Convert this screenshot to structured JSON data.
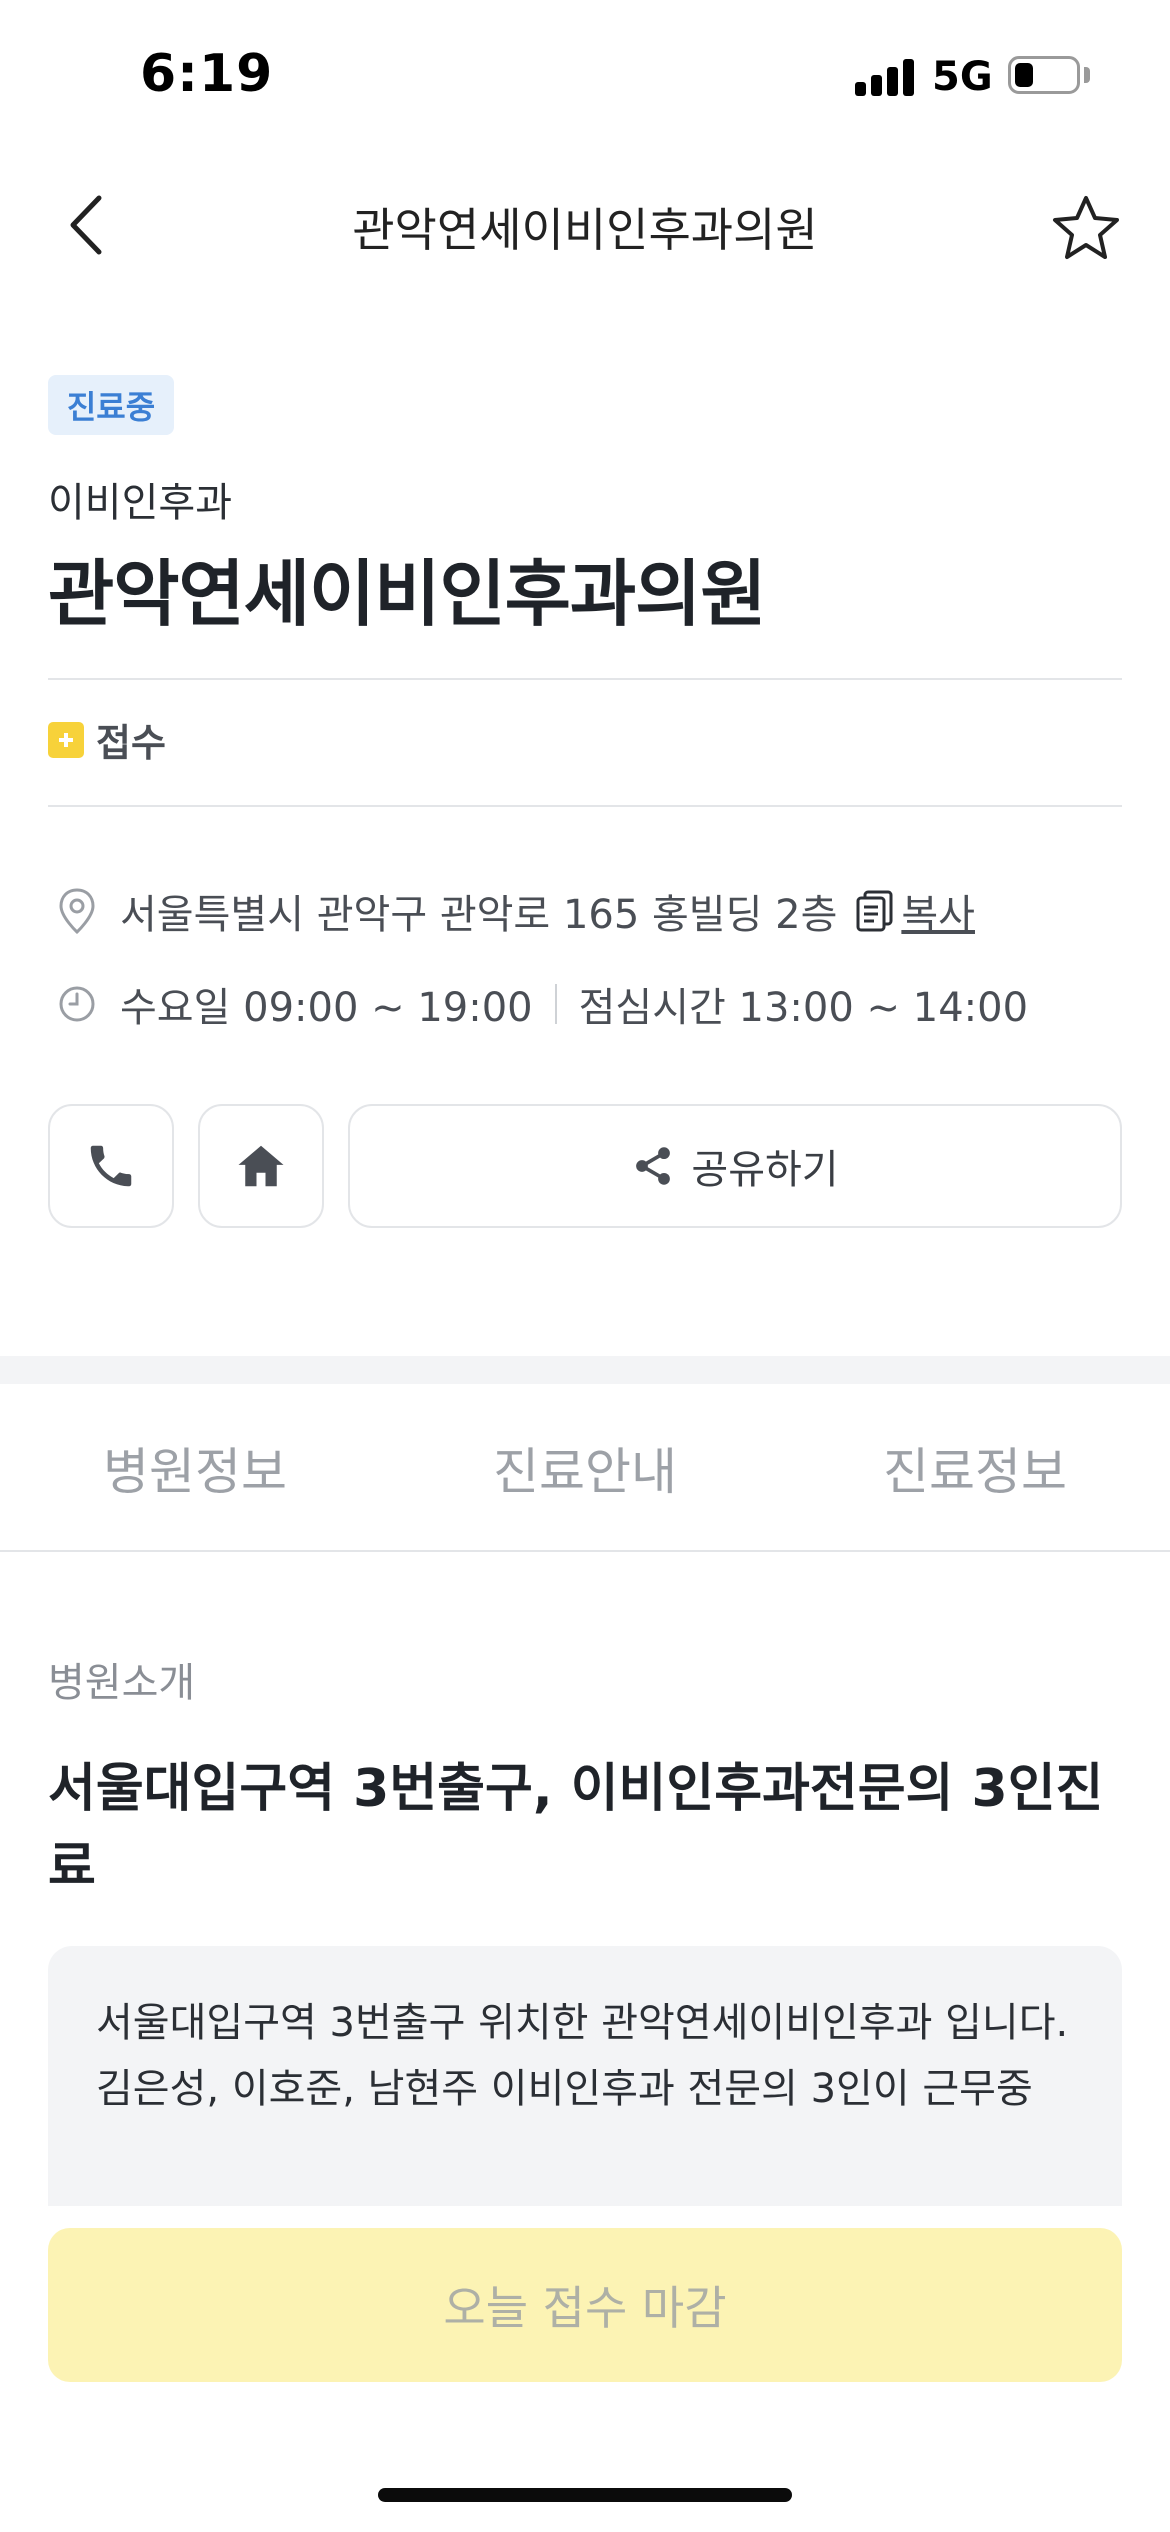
{
  "status_bar": {
    "time": "6:19",
    "network": "5G"
  },
  "nav": {
    "title": "관악연세이비인후과의원",
    "back_icon": "chevron-left-icon",
    "favorite_icon": "star-outline-icon"
  },
  "hospital": {
    "status_badge": "진료중",
    "department": "이비인후과",
    "name": "관악연세이비인후과의원",
    "reception_label": "접수"
  },
  "info": {
    "address": "서울특별시 관악구 관악로 165 홍빌딩 2층",
    "copy_label": "복사",
    "hours": "수요일 09:00 ~ 19:00",
    "lunch": "점심시간 13:00 ~ 14:00"
  },
  "actions": {
    "share_label": "공유하기"
  },
  "tabs": [
    {
      "label": "병원정보"
    },
    {
      "label": "진료안내"
    },
    {
      "label": "진료정보"
    }
  ],
  "intro": {
    "section_label": "병원소개",
    "title": "서울대입구역 3번출구, 이비인후과전문의 3인진료",
    "body": "서울대입구역 3번출구 위치한 관악연세이비인후과 입니다.\n김은성, 이호준, 남현주 이비인후과 전문의 3인이 근무중"
  },
  "bottom_button": {
    "label": "오늘 접수 마감"
  },
  "colors": {
    "badge_text": "#3b7fd4",
    "badge_bg": "#e6f0fb",
    "reception_icon": "#f7d23a",
    "bottom_button_bg": "#fcf3b4"
  }
}
